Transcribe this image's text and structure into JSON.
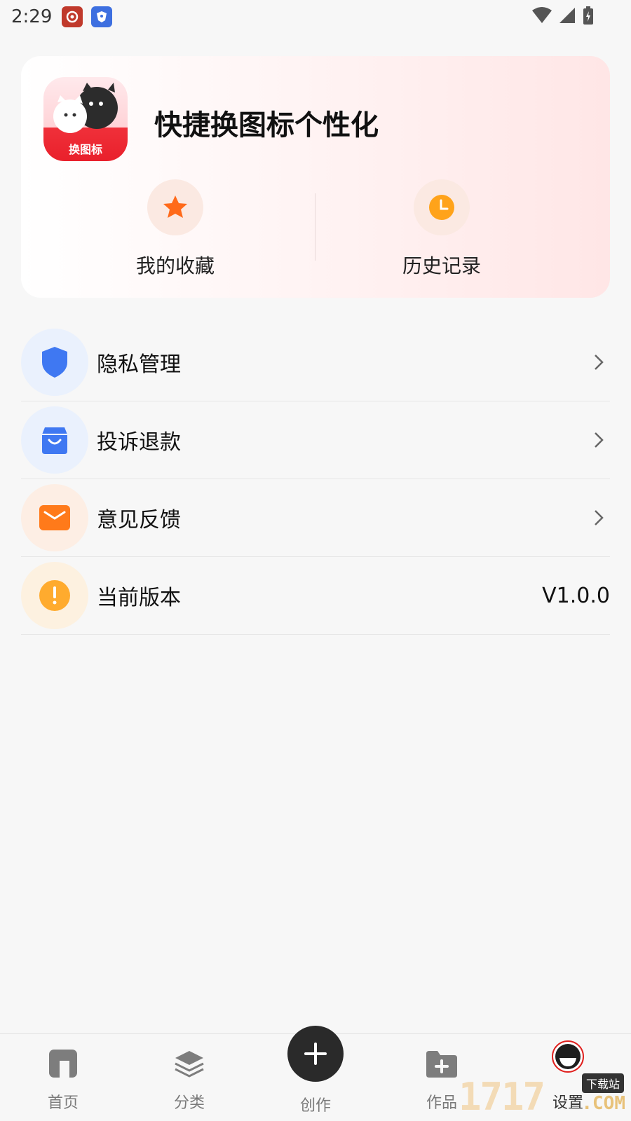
{
  "status_bar": {
    "time": "2:29"
  },
  "header": {
    "logo_text": "换图标",
    "app_title": "快捷换图标个性化",
    "quick_actions": [
      {
        "label": "我的收藏",
        "icon": "star-icon"
      },
      {
        "label": "历史记录",
        "icon": "clock-icon"
      }
    ]
  },
  "settings": {
    "items": [
      {
        "label": "隐私管理",
        "icon": "shield-icon",
        "color": "#3f78f2"
      },
      {
        "label": "投诉退款",
        "icon": "shopping-bag-icon",
        "color": "#3f78f2"
      },
      {
        "label": "意见反馈",
        "icon": "envelope-icon",
        "color": "#ff7a1a"
      },
      {
        "label": "当前版本",
        "icon": "exclamation-icon",
        "color": "#ffab2e",
        "value": "V1.0.0"
      }
    ]
  },
  "bottom_nav": {
    "items": [
      {
        "label": "首页",
        "icon": "home-icon"
      },
      {
        "label": "分类",
        "icon": "layers-icon"
      },
      {
        "label": "创作",
        "icon": "plus-icon"
      },
      {
        "label": "作品",
        "icon": "folder-plus-icon"
      },
      {
        "label": "设置",
        "icon": "settings-avatar-icon"
      }
    ]
  },
  "watermark": {
    "text": "1717",
    "tag": "下载站",
    "suffix": ".COM"
  },
  "colors": {
    "accent": "#f0303a",
    "background": "#f7f7f7"
  }
}
